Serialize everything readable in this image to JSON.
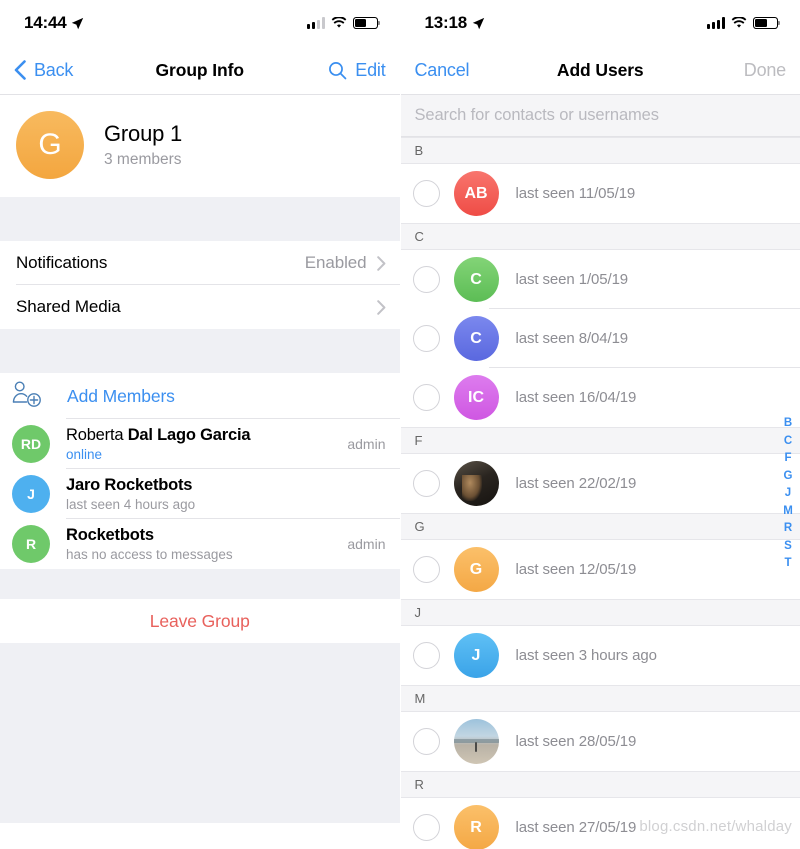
{
  "left": {
    "status": {
      "time": "14:44",
      "location_icon": "location-arrow-icon",
      "signal_bars": 2,
      "wifi_icon": "wifi-icon",
      "battery_icon": "battery-icon",
      "battery_level": 55
    },
    "nav": {
      "back_label": "Back",
      "back_icon": "chevron-left-icon",
      "title": "Group Info",
      "search_icon": "search-icon",
      "edit_label": "Edit"
    },
    "group": {
      "avatar_initial": "G",
      "avatar_color": "#f3a63f",
      "name": "Group 1",
      "members_count": "3 members"
    },
    "settings": [
      {
        "label": "Notifications",
        "value": "Enabled",
        "chevron": "chevron-right-icon"
      },
      {
        "label": "Shared Media",
        "value": "",
        "chevron": "chevron-right-icon"
      }
    ],
    "add_members": {
      "label": "Add Members",
      "icon": "add-person-icon",
      "color": "#3b8ff0"
    },
    "members": [
      {
        "initials": "RD",
        "avatar_color": "#6fc96a",
        "name_first": "Roberta ",
        "name_rest": "Dal Lago Garcia",
        "status": "online",
        "status_type": "online",
        "badge": "admin"
      },
      {
        "initials": "J",
        "avatar_color": "#4eb0ef",
        "name_first": "Jaro Rocketbots",
        "name_rest": "",
        "status": "last seen 4 hours ago",
        "status_type": "muted",
        "badge": ""
      },
      {
        "initials": "R",
        "avatar_color": "#6fc96a",
        "name_first": "Rocketbots",
        "name_rest": "",
        "status": "has no access to messages",
        "status_type": "muted",
        "badge": "admin"
      }
    ],
    "leave": {
      "label": "Leave Group",
      "color": "#e8615c"
    }
  },
  "right": {
    "status": {
      "time": "13:18",
      "location_icon": "location-arrow-icon",
      "signal_bars": 4,
      "wifi_icon": "wifi-icon",
      "battery_icon": "battery-icon",
      "battery_level": 55
    },
    "nav": {
      "cancel_label": "Cancel",
      "title": "Add Users",
      "done_label": "Done"
    },
    "search": {
      "placeholder": "Search for contacts or usernames"
    },
    "sections": [
      {
        "letter": "B",
        "rows": [
          {
            "checkbox": "unchecked",
            "avatar_type": "initials",
            "initials": "AB",
            "avatar_color": "#f4615c",
            "seen": "last seen 11/05/19"
          }
        ]
      },
      {
        "letter": "C",
        "rows": [
          {
            "checkbox": "unchecked",
            "avatar_type": "initials",
            "initials": "C",
            "avatar_color": "#6fc96a",
            "seen": "last seen 1/05/19"
          },
          {
            "checkbox": "unchecked",
            "avatar_type": "initials",
            "initials": "C",
            "avatar_color": "#6a7ce8",
            "seen": "last seen 8/04/19"
          },
          {
            "checkbox": "unchecked",
            "avatar_type": "initials",
            "initials": "IC",
            "avatar_color": "#d469e8",
            "seen": "last seen 16/04/19"
          }
        ]
      },
      {
        "letter": "F",
        "rows": [
          {
            "checkbox": "unchecked",
            "avatar_type": "photo-dark",
            "initials": "",
            "avatar_color": "#2a2520",
            "seen": "last seen 22/02/19"
          }
        ]
      },
      {
        "letter": "G",
        "rows": [
          {
            "checkbox": "unchecked",
            "avatar_type": "initials",
            "initials": "G",
            "avatar_color": "#f7b256",
            "seen": "last seen 12/05/19"
          }
        ]
      },
      {
        "letter": "J",
        "rows": [
          {
            "checkbox": "unchecked",
            "avatar_type": "initials",
            "initials": "J",
            "avatar_color": "#4eb0ef",
            "seen": "last seen 3 hours ago"
          }
        ]
      },
      {
        "letter": "M",
        "rows": [
          {
            "checkbox": "unchecked",
            "avatar_type": "photo-beach",
            "initials": "",
            "avatar_color": "#b9c6cf",
            "seen": "last seen 28/05/19"
          }
        ]
      },
      {
        "letter": "R",
        "rows": [
          {
            "checkbox": "unchecked",
            "avatar_type": "initials",
            "initials": "R",
            "avatar_color": "#f7b256",
            "seen": "last seen 27/05/19"
          }
        ]
      }
    ],
    "alpha_index": [
      "B",
      "C",
      "F",
      "G",
      "J",
      "M",
      "R",
      "S",
      "T"
    ],
    "watermark": "blog.csdn.net/whalday"
  }
}
